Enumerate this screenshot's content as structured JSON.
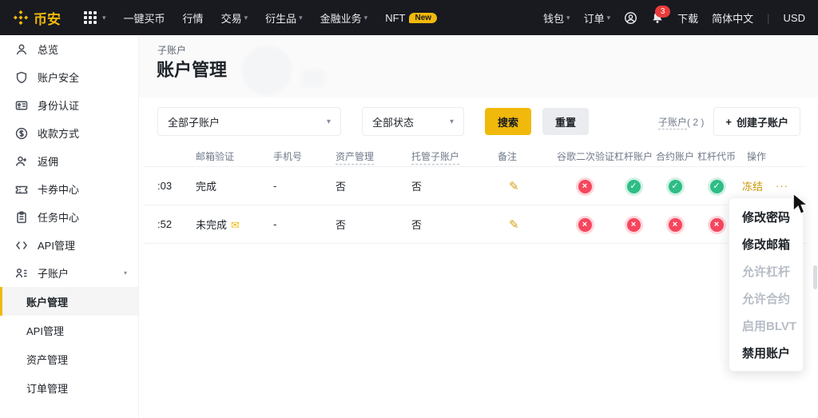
{
  "navbar": {
    "logo_text": "币安",
    "menu": [
      {
        "label": "一键买币",
        "caret": false
      },
      {
        "label": "行情",
        "caret": false
      },
      {
        "label": "交易",
        "caret": true
      },
      {
        "label": "衍生品",
        "caret": true
      },
      {
        "label": "金融业务",
        "caret": true
      },
      {
        "label": "NFT",
        "caret": false,
        "badge": "New"
      }
    ],
    "right": {
      "wallet": "钱包",
      "orders": "订单",
      "notification_count": "3",
      "download": "下载",
      "language": "简体中文",
      "currency": "USD",
      "divider": "|"
    }
  },
  "sidebar": {
    "items": [
      {
        "label": "总览",
        "icon": "user-icon"
      },
      {
        "label": "账户安全",
        "icon": "shield-icon"
      },
      {
        "label": "身份认证",
        "icon": "id-card-icon"
      },
      {
        "label": "收款方式",
        "icon": "dollar-icon"
      },
      {
        "label": "返佣",
        "icon": "user-plus-icon"
      },
      {
        "label": "卡券中心",
        "icon": "ticket-icon"
      },
      {
        "label": "任务中心",
        "icon": "clipboard-icon"
      },
      {
        "label": "API管理",
        "icon": "api-icon"
      },
      {
        "label": "子账户",
        "icon": "users-icon",
        "expanded": true
      }
    ],
    "subitems": [
      {
        "label": "账户管理",
        "active": true
      },
      {
        "label": "API管理",
        "active": false
      },
      {
        "label": "资产管理",
        "active": false
      },
      {
        "label": "订单管理",
        "active": false
      }
    ]
  },
  "header": {
    "breadcrumb": "子账户",
    "title": "账户管理"
  },
  "filters": {
    "account_select_value": "全部子账户",
    "status_select_value": "全部状态",
    "search_label": "搜索",
    "reset_label": "重置",
    "count_text": "子账户",
    "count_value": "( 2 )",
    "create_plus": "+",
    "create_label": "创建子账户"
  },
  "table": {
    "headers": [
      "邮箱验证",
      "手机号",
      "资产管理",
      "托管子账户",
      "备注",
      "谷歌二次验证",
      "杠杆账户",
      "合约账户",
      "杠杆代币",
      "操作"
    ],
    "rows": [
      {
        "account": ":03",
        "email_status": "完成",
        "phone": "-",
        "asset_mgmt": "否",
        "managed": "否",
        "google_2fa": "disabled",
        "margin": "enabled",
        "futures": "enabled",
        "blvt": "enabled",
        "action": "冻结",
        "more": "···"
      },
      {
        "account": ":52",
        "email_status": "未完成",
        "phone": "-",
        "asset_mgmt": "否",
        "managed": "否",
        "google_2fa": "disabled",
        "margin": "disabled",
        "futures": "disabled",
        "blvt": "disabled",
        "action": "",
        "more": ""
      }
    ]
  },
  "context_menu": {
    "items": [
      {
        "label": "修改密码",
        "enabled": true
      },
      {
        "label": "修改邮箱",
        "enabled": true
      },
      {
        "label": "允许杠杆",
        "enabled": false
      },
      {
        "label": "允许合约",
        "enabled": false
      },
      {
        "label": "启用BLVT",
        "enabled": false
      },
      {
        "label": "禁用账户",
        "enabled": true
      }
    ]
  },
  "icons": {
    "caret_down": "▾",
    "collapse_caret": "▾",
    "check": "✓",
    "cross": "×",
    "pencil": "✎",
    "envelope": "✉",
    "more": "···"
  },
  "colors": {
    "brand": "#F0B90B",
    "danger": "#F6465D",
    "success": "#2EBD85",
    "gold_link": "#C99400",
    "nav_bg": "#181A20"
  }
}
